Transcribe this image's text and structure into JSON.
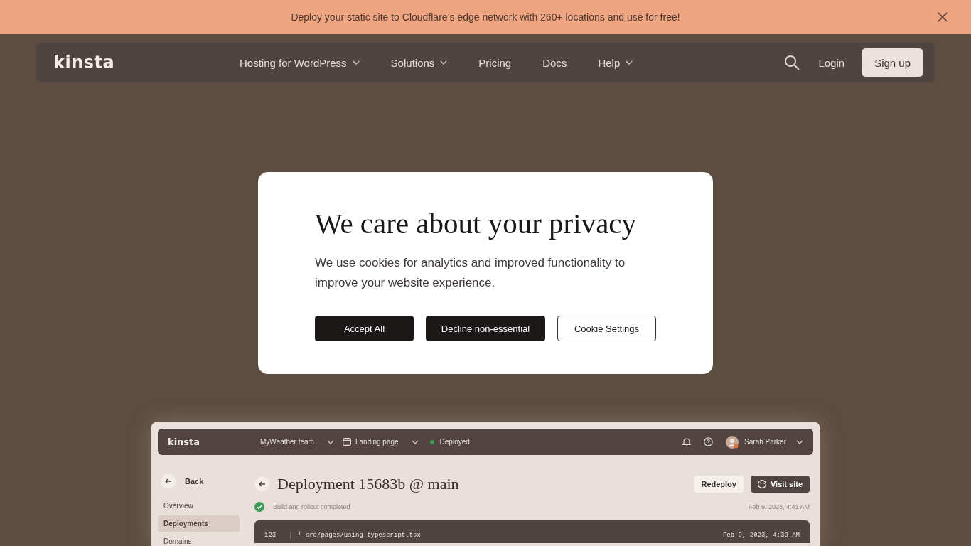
{
  "banner": {
    "text": "Deploy your static site to Cloudflare’s edge network with 260+ locations and use for free!"
  },
  "nav": {
    "logo": "kinsta",
    "items": [
      {
        "label": "Hosting for WordPress",
        "dropdown": true
      },
      {
        "label": "Solutions",
        "dropdown": true
      },
      {
        "label": "Pricing",
        "dropdown": false
      },
      {
        "label": "Docs",
        "dropdown": false
      },
      {
        "label": "Help",
        "dropdown": true
      }
    ],
    "login": "Login",
    "signup": "Sign up"
  },
  "cookie_dialog": {
    "title": "We care about your privacy",
    "body": "We use cookies for analytics and improved functionality to improve your website experience.",
    "buttons": [
      {
        "label": "Accept All",
        "kind": "primary"
      },
      {
        "label": "Decline non-essential",
        "kind": "primary"
      },
      {
        "label": "Cookie Settings",
        "kind": "outline"
      }
    ]
  },
  "app_preview": {
    "logo": "kinsta",
    "team": "MyWeather team",
    "site": "Landing page",
    "status": "Deployed",
    "user": "Sarah Parker",
    "back": "Back",
    "sidebar": [
      {
        "label": "Overview",
        "selected": false
      },
      {
        "label": "Deployments",
        "selected": true
      },
      {
        "label": "Domains",
        "selected": false
      }
    ],
    "title": "Deployment 15683b @ main",
    "buttons": [
      {
        "label": "Redeploy",
        "kind": "light"
      },
      {
        "label": "Visit site",
        "kind": "dark"
      }
    ],
    "build_status": "Build and rollout completed",
    "build_time": "Feb 9, 2023, 4:41 AM",
    "log": [
      {
        "line": "123",
        "text": "└ src/pages/using-typescript.tsx",
        "time": "Feb 9, 2023, 4:39 AM"
      }
    ]
  }
}
